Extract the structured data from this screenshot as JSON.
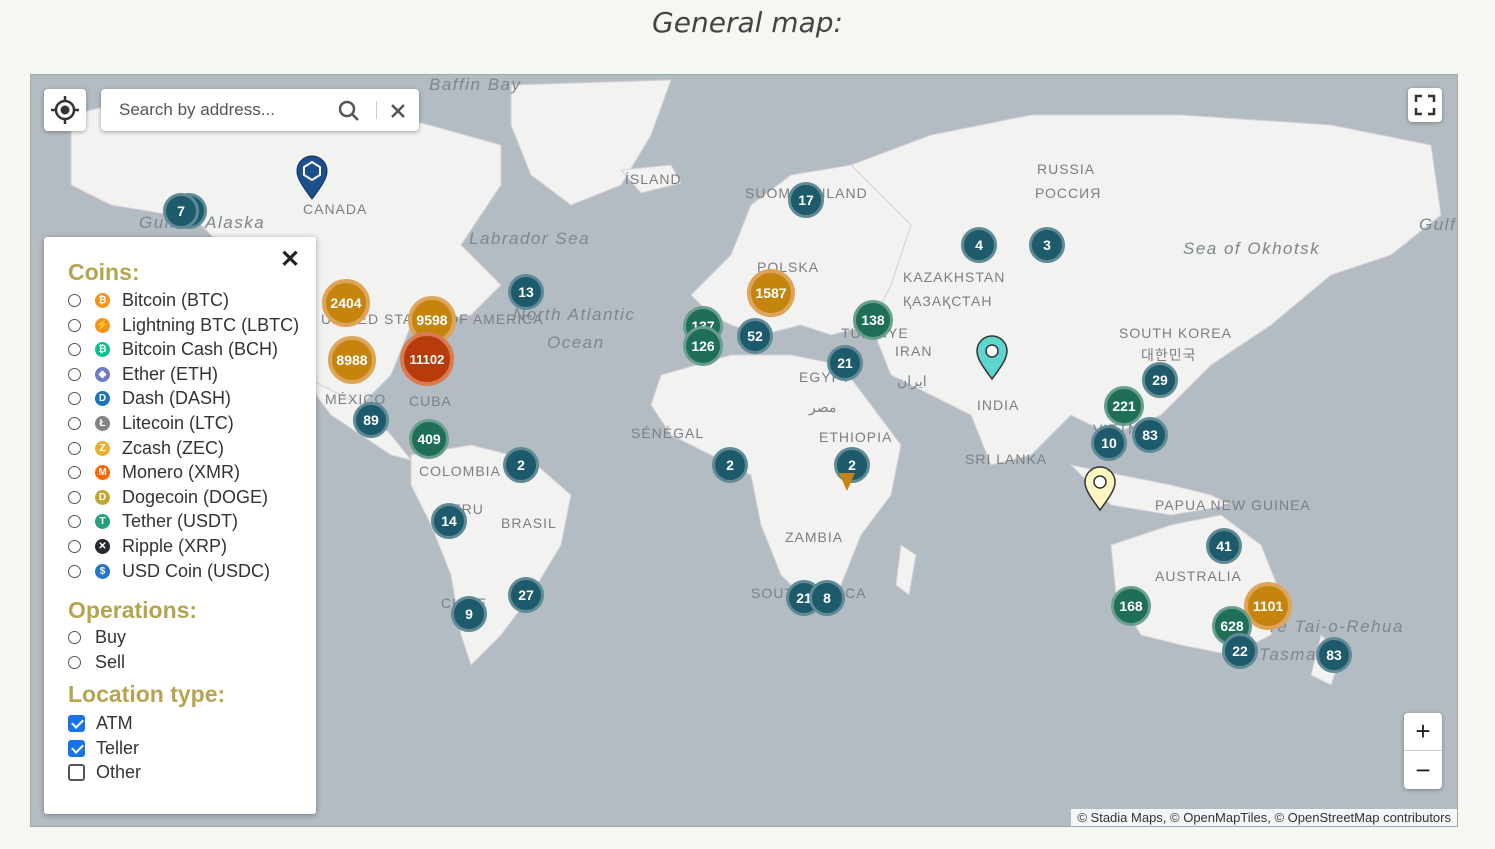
{
  "page_title": "General map:",
  "search": {
    "placeholder": "Search by address..."
  },
  "zoom": {
    "in_label": "+",
    "out_label": "−"
  },
  "attribution": "© Stadia Maps, © OpenMapTiles, © OpenStreetMap contributors",
  "legend": {
    "close_label": "✕",
    "coins_heading": "Coins:",
    "coins": [
      {
        "label": "Bitcoin (BTC)",
        "color": "#f7931a",
        "glyph": "₿"
      },
      {
        "label": "Lightning BTC (LBTC)",
        "color": "#f7931a",
        "glyph": "⚡"
      },
      {
        "label": "Bitcoin Cash (BCH)",
        "color": "#0ac18e",
        "glyph": "₿"
      },
      {
        "label": "Ether (ETH)",
        "color": "#6b7cc0",
        "glyph": "◆"
      },
      {
        "label": "Dash (DASH)",
        "color": "#1c75bc",
        "glyph": "D"
      },
      {
        "label": "Litecoin (LTC)",
        "color": "#838383",
        "glyph": "Ł"
      },
      {
        "label": "Zcash (ZEC)",
        "color": "#e8b030",
        "glyph": "Z"
      },
      {
        "label": "Monero (XMR)",
        "color": "#ff6600",
        "glyph": "M"
      },
      {
        "label": "Dogecoin (DOGE)",
        "color": "#c2a633",
        "glyph": "D"
      },
      {
        "label": "Tether (USDT)",
        "color": "#26a17b",
        "glyph": "T"
      },
      {
        "label": "Ripple (XRP)",
        "color": "#23292f",
        "glyph": "✕"
      },
      {
        "label": "USD Coin (USDC)",
        "color": "#2775ca",
        "glyph": "$"
      }
    ],
    "operations_heading": "Operations:",
    "operations": [
      {
        "label": "Buy"
      },
      {
        "label": "Sell"
      }
    ],
    "location_heading": "Location type:",
    "location_types": [
      {
        "label": "ATM",
        "checked": true
      },
      {
        "label": "Teller",
        "checked": true
      },
      {
        "label": "Other",
        "checked": false
      }
    ]
  },
  "place_labels": [
    "Baffin Bay",
    "Gulf of Alaska",
    "CANADA",
    "Labrador Sea",
    "ÍSLAND",
    "SUOMI FINLAND",
    "RUSSIA",
    "РОССИЯ",
    "Sea of Okhotsk",
    "Gulf",
    "KAZAKHSTAN",
    "ҚАЗАҚСТАН",
    "POLSKA",
    "North Atlantic",
    "Ocean",
    "UNITED STATES OF AMERICA",
    "TÜRKIYE",
    "IRAN",
    "ایران",
    "SOUTH KOREA",
    "대한민국",
    "EGYPT",
    "مصر",
    "INDIA",
    "MÉXICO",
    "CUBA",
    "SÉNÉGAL",
    "ETHIOPIA",
    "SRI LANKA",
    "VIETNAM",
    "COLOMBIA",
    "BRASIL",
    "PERU",
    "PAPUA NEW GUINEA",
    "ZAMBIA",
    "AUSTRALIA",
    "SOUTH AFRICA",
    "CHILE",
    "Te Tai-o-Rehua",
    "Tasman"
  ],
  "clusters": [
    {
      "count": "7",
      "style": "teal"
    },
    {
      "count": "",
      "style": "teal"
    },
    {
      "count": "2404",
      "style": "orange"
    },
    {
      "count": "9598",
      "style": "orange"
    },
    {
      "count": "8988",
      "style": "orange"
    },
    {
      "count": "11102",
      "style": "red"
    },
    {
      "count": "13",
      "style": "teal"
    },
    {
      "count": "89",
      "style": "teal"
    },
    {
      "count": "409",
      "style": "green"
    },
    {
      "count": "2",
      "style": "teal"
    },
    {
      "count": "14",
      "style": "teal"
    },
    {
      "count": "27",
      "style": "teal"
    },
    {
      "count": "9",
      "style": "teal"
    },
    {
      "count": "17",
      "style": "teal"
    },
    {
      "count": "1587",
      "style": "orange"
    },
    {
      "count": "137",
      "style": "green"
    },
    {
      "count": "126",
      "style": "green"
    },
    {
      "count": "52",
      "style": "teal"
    },
    {
      "count": "138",
      "style": "green"
    },
    {
      "count": "21",
      "style": "teal"
    },
    {
      "count": "4",
      "style": "teal"
    },
    {
      "count": "3",
      "style": "teal"
    },
    {
      "count": "2",
      "style": "teal"
    },
    {
      "count": "2",
      "style": "teal"
    },
    {
      "count": "21",
      "style": "teal"
    },
    {
      "count": "8",
      "style": "teal"
    },
    {
      "count": "29",
      "style": "teal"
    },
    {
      "count": "221",
      "style": "green"
    },
    {
      "count": "10",
      "style": "teal"
    },
    {
      "count": "83",
      "style": "teal"
    },
    {
      "count": "41",
      "style": "teal"
    },
    {
      "count": "168",
      "style": "green"
    },
    {
      "count": "1101",
      "style": "orange"
    },
    {
      "count": "628",
      "style": "green"
    },
    {
      "count": "22",
      "style": "teal"
    },
    {
      "count": "83",
      "style": "teal"
    }
  ],
  "pins": [
    {
      "type": "logo-marker-icon",
      "color": "#1d4f8c"
    },
    {
      "type": "teal-pin-icon",
      "color": "#5dd6d0"
    },
    {
      "type": "yellow-pin-icon",
      "color": "#fdf6c3"
    },
    {
      "type": "orange-pin-icon",
      "color": "#c4840e"
    }
  ]
}
